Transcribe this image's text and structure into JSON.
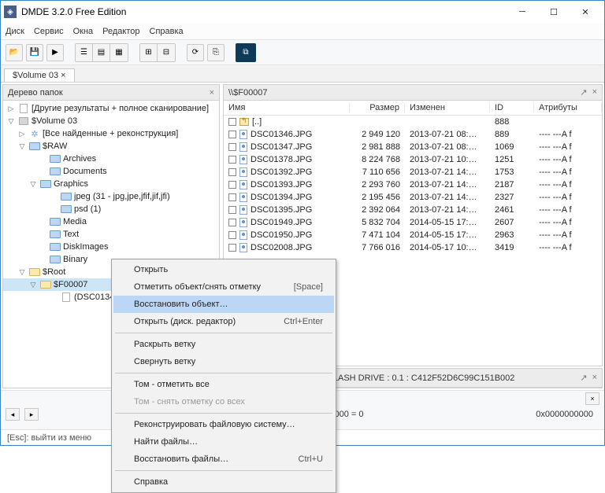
{
  "title": "DMDE 3.2.0 Free Edition",
  "menu": {
    "disk": "Диск",
    "service": "Сервис",
    "windows": "Окна",
    "editor": "Редактор",
    "help": "Справка"
  },
  "tab": "$Volume 03",
  "tree_header": "Дерево папок",
  "right_header": "\\\\$F00007",
  "tree": {
    "root": "[Другие результаты + полное сканирование]",
    "volume": "$Volume 03",
    "raw": "[Все найденные + реконструкция]",
    "sraw": "$RAW",
    "archives": "Archives",
    "documents": "Documents",
    "graphics": "Graphics",
    "jpeg": "jpeg (31 - jpg,jpe,jfif,jif,jfi)",
    "psd": "psd (1)",
    "media": "Media",
    "text": "Text",
    "diskimages": "DiskImages",
    "binary": "Binary",
    "sroot": "$Root",
    "sf": "$F00007",
    "dsc": "(DSC0134"
  },
  "cols": {
    "name": "Имя",
    "size": "Размер",
    "mod": "Изменен",
    "id": "ID",
    "attr": "Атрибуты"
  },
  "updir": "[..]",
  "updir_id": "888",
  "files": [
    {
      "name": "DSC01346.JPG",
      "size": "2 949 120",
      "mod": "2013-07-21 08:…",
      "id": "889",
      "attr": "---- ---A  f"
    },
    {
      "name": "DSC01347.JPG",
      "size": "2 981 888",
      "mod": "2013-07-21 08:…",
      "id": "1069",
      "attr": "---- ---A  f"
    },
    {
      "name": "DSC01378.JPG",
      "size": "8 224 768",
      "mod": "2013-07-21 10:…",
      "id": "1251",
      "attr": "---- ---A  f"
    },
    {
      "name": "DSC01392.JPG",
      "size": "7 110 656",
      "mod": "2013-07-21 14:…",
      "id": "1753",
      "attr": "---- ---A  f"
    },
    {
      "name": "DSC01393.JPG",
      "size": "2 293 760",
      "mod": "2013-07-21 14:…",
      "id": "2187",
      "attr": "---- ---A  f"
    },
    {
      "name": "DSC01394.JPG",
      "size": "2 195 456",
      "mod": "2013-07-21 14:…",
      "id": "2327",
      "attr": "---- ---A  f"
    },
    {
      "name": "DSC01395.JPG",
      "size": "2 392 064",
      "mod": "2013-07-21 14:…",
      "id": "2461",
      "attr": "---- ---A  f"
    },
    {
      "name": "DSC01949.JPG",
      "size": "5 832 704",
      "mod": "2014-05-15 17:…",
      "id": "2607",
      "attr": "---- ---A  f"
    },
    {
      "name": "DSC01950.JPG",
      "size": "7 471 104",
      "mod": "2014-05-15 17:…",
      "id": "2963",
      "attr": "---- ---A  f"
    },
    {
      "name": "DSC02008.JPG",
      "size": "7 766 016",
      "mod": "2014-05-17 10:…",
      "id": "3419",
      "attr": "---- ---A  f"
    }
  ],
  "device": "15.5 GB - TOSHIBA USB FLASH DRIVE : 0.1 : C412F52D6C99C151B002",
  "offsets": {
    "left": "0: 0x00007180 = 29 056  Pos: 0x0000 = 0",
    "right": "0x0000000000"
  },
  "statusbar": "[Esc]: выйти из меню",
  "cm": {
    "open": "Открыть",
    "mark": "Отметить объект/снять отметку",
    "mark_sc": "[Space]",
    "recover": "Восстановить объект…",
    "open_disk": "Открыть (диск. редактор)",
    "open_disk_sc": "Ctrl+Enter",
    "expand": "Раскрыть ветку",
    "collapse": "Свернуть ветку",
    "mark_all": "Том - отметить все",
    "unmark_all": "Том - снять отметку со всех",
    "reconstruct": "Реконструировать файловую систему…",
    "find": "Найти файлы…",
    "recover_files": "Восстановить файлы…",
    "recover_files_sc": "Ctrl+U",
    "help": "Справка"
  }
}
